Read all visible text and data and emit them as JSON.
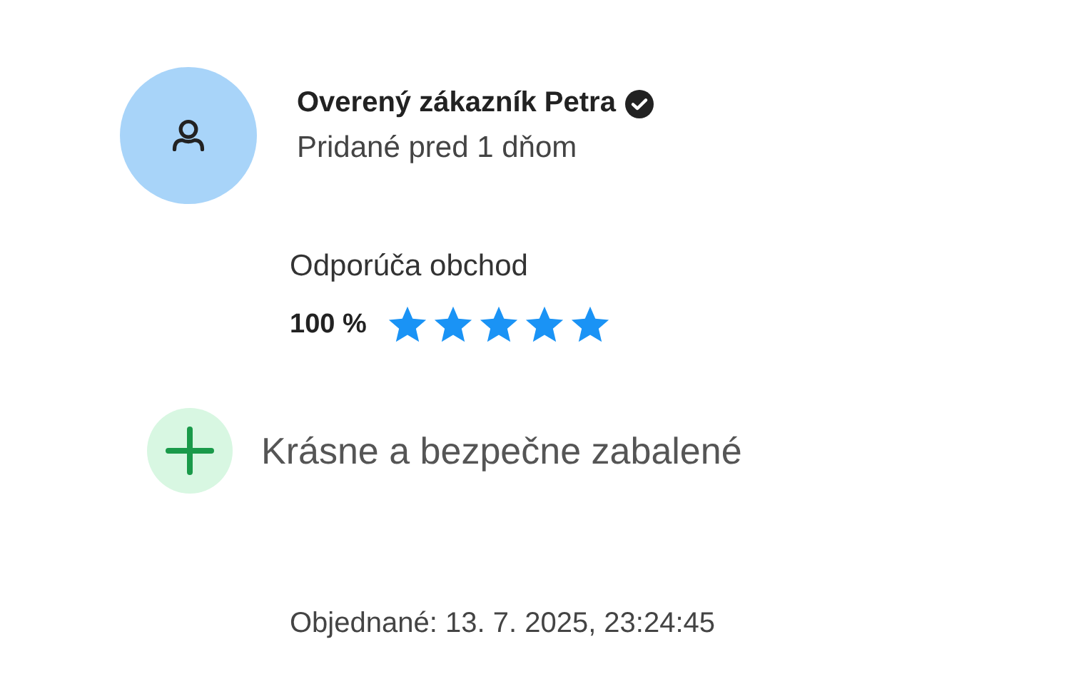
{
  "reviewer": {
    "name": "Overený zákazník Petra",
    "verified": true,
    "added": "Pridané pred 1 dňom"
  },
  "recommendation": {
    "label": "Odporúča obchod",
    "percent": "100 %",
    "stars": 5
  },
  "points": [
    {
      "kind": "pro",
      "text": "Krásne a bezpečne zabalené"
    }
  ],
  "ordered": "Objednané: 13. 7. 2025, 23:24:45"
}
